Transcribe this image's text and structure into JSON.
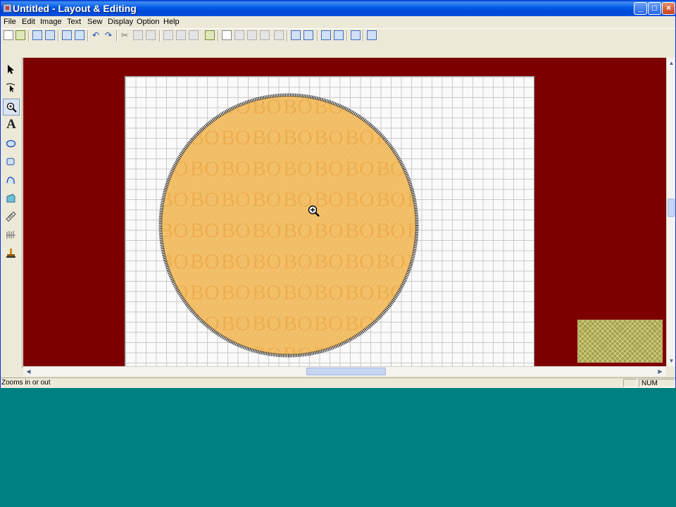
{
  "window": {
    "title": "Untitled - Layout & Editing",
    "controls": {
      "minimize": "_",
      "maximize": "□",
      "close": "×"
    }
  },
  "menu": {
    "items": [
      "File",
      "Edit",
      "Image",
      "Text",
      "Sew",
      "Display",
      "Option",
      "Help"
    ]
  },
  "palette": {
    "tools": [
      "select-tool",
      "point-edit-tool",
      "zoom-tool",
      "text-tool",
      "circle-tool",
      "shape-tool",
      "outline-tool",
      "fill-tool",
      "measure-tool",
      "stitch-tool",
      "stamp-tool"
    ],
    "active_tool": "zoom-tool",
    "text_tool_glyph": "A"
  },
  "canvas": {
    "background_color": "#7d0000",
    "sheet_color": "#fafafa",
    "design": {
      "fill_color": "#f3c06a",
      "border_color": "#2a2a2a",
      "pattern_text": "BO"
    }
  },
  "status": {
    "message": "Zooms in or out",
    "num_indicator": "NUM"
  }
}
